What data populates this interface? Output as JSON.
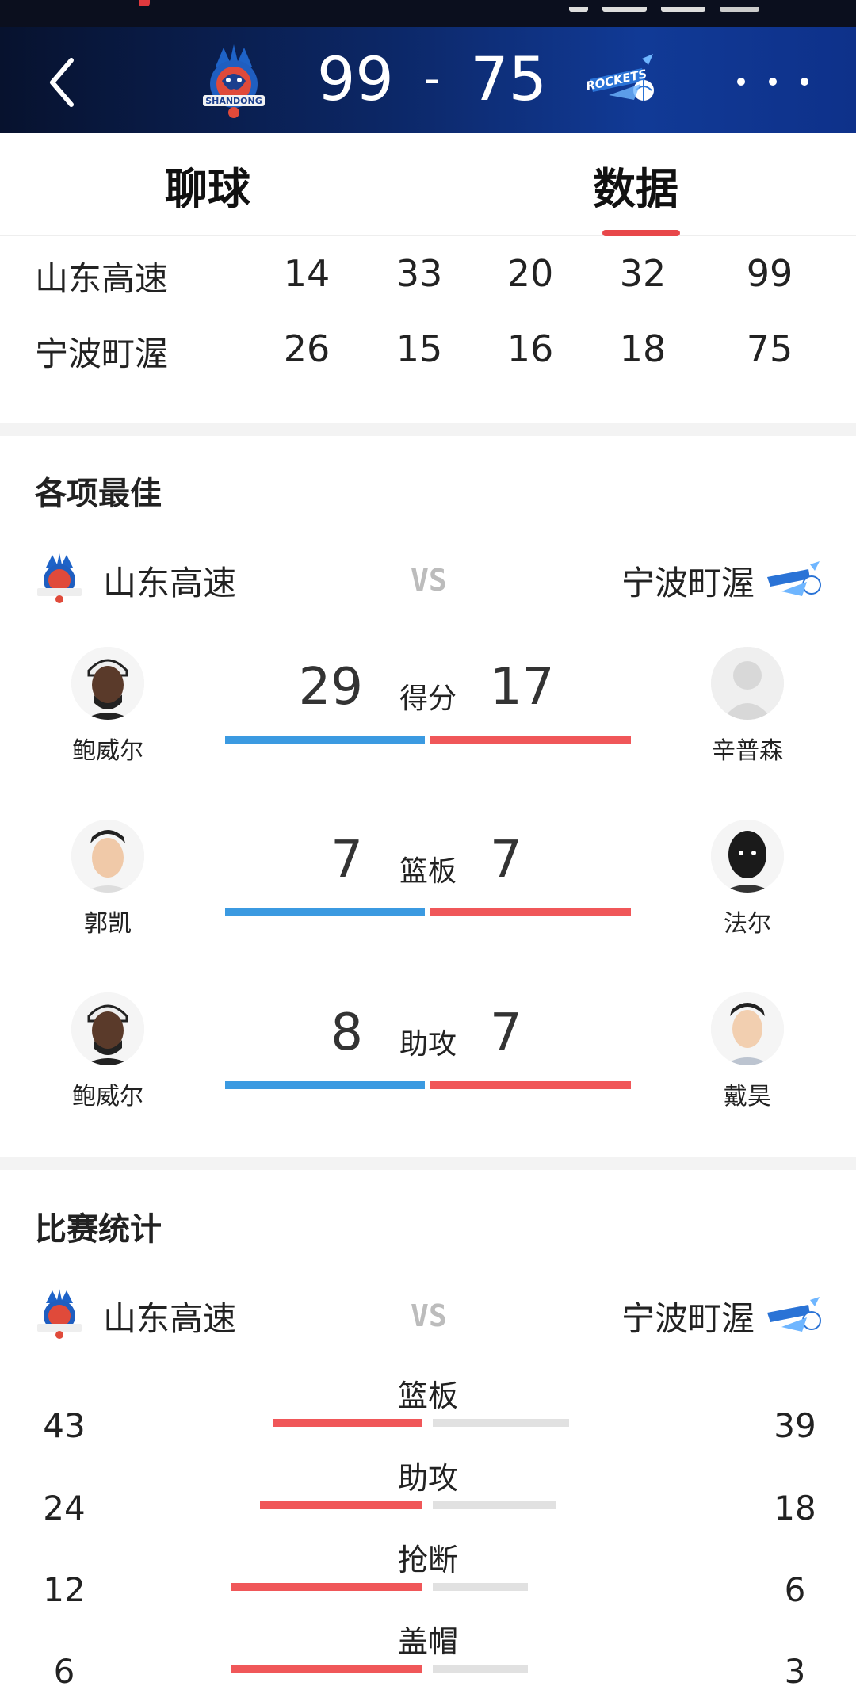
{
  "header": {
    "home_score": "99",
    "separator": "-",
    "away_score": "75",
    "home_logo_text": "SHANDONG",
    "away_logo_text": "ROCKETS"
  },
  "tabs": [
    {
      "label": "聊球"
    },
    {
      "label": "数据"
    }
  ],
  "quarter_scores": [
    {
      "team": "山东高速",
      "q": [
        "14",
        "33",
        "20",
        "32"
      ],
      "total": "99"
    },
    {
      "team": "宁波町渥",
      "q": [
        "26",
        "15",
        "16",
        "18"
      ],
      "total": "75"
    }
  ],
  "best": {
    "title": "各项最佳",
    "home_team": "山东高速",
    "away_team": "宁波町渥",
    "vs": "VS",
    "items": [
      {
        "label": "得分",
        "home_value": "29",
        "away_value": "17",
        "home_player": "鲍威尔",
        "away_player": "辛普森"
      },
      {
        "label": "篮板",
        "home_value": "7",
        "away_value": "7",
        "home_player": "郭凯",
        "away_player": "法尔"
      },
      {
        "label": "助攻",
        "home_value": "8",
        "away_value": "7",
        "home_player": "鲍威尔",
        "away_player": "戴昊"
      }
    ]
  },
  "stats": {
    "title": "比赛统计",
    "home_team": "山东高速",
    "away_team": "宁波町渥",
    "vs": "VS",
    "items": [
      {
        "label": "篮板",
        "home": "43",
        "away": "39"
      },
      {
        "label": "助攻",
        "home": "24",
        "away": "18"
      },
      {
        "label": "抢断",
        "home": "12",
        "away": "6"
      },
      {
        "label": "盖帽",
        "home": "6",
        "away": "3"
      }
    ]
  },
  "colors": {
    "header_dark": "#07122e",
    "header_blue": "#113a96",
    "accent_red": "#f05759",
    "accent_blue": "#3b9ae1",
    "tab_underline": "#e8474a",
    "vs_gray": "#bcbcbc"
  }
}
